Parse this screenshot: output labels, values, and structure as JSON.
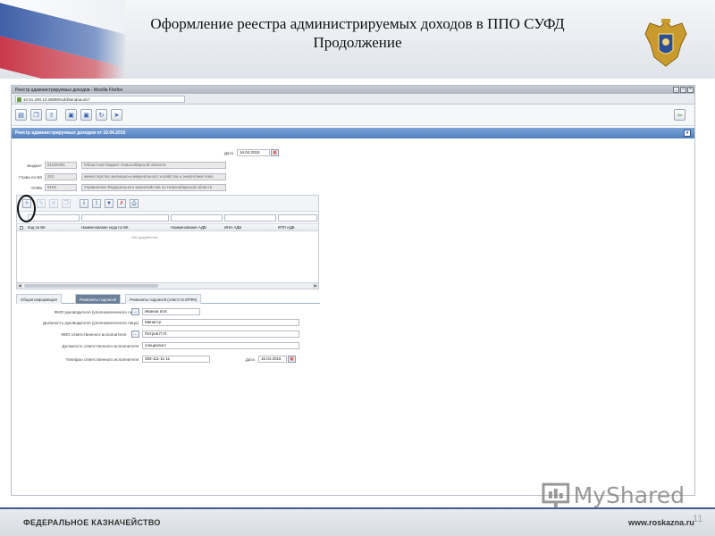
{
  "slide": {
    "title_line1": "Оформление реестра администрируемых доходов в ППО СУФД",
    "title_line2": "Продолжение",
    "footer_left": "ФЕДЕРАЛЬНОЕ КАЗНАЧЕЙСТВО",
    "footer_right": "www.roskazna.ru",
    "page_number": "11",
    "watermark": "MyShared"
  },
  "browser": {
    "window_title": "Реестр администрируемых доходов - Mozilla Firefox",
    "url": "10.51.200.12:28080/sufd/window.do?docSessionId=a72c9abc351bb57caf8d324790c96be6",
    "window_buttons": [
      "_",
      "□",
      "×"
    ]
  },
  "form": {
    "panel_title": "Реестр администрируемых доходов от 16.04.2015",
    "date_label": "Дата",
    "date_value": "16.04.2015",
    "budget_label": "Бюджет",
    "budget_code": "51020491",
    "budget_name": "Областной бюджет Новосибирской области",
    "glava_label": "Глава по БК",
    "glava_code": "210",
    "glava_name": "министерство жилищно-коммунального хозяйства и энергетики Ново",
    "tofk_label": "ТОФК",
    "tofk_code": "5100",
    "tofk_name": "Управление Федерального казначейства по Новосибирской области"
  },
  "grid": {
    "columns": [
      "Код по БК",
      "Наименование кода по БК",
      "Наименование АДБ",
      "ИНН АДБ",
      "КПП АДБ"
    ],
    "empty_message": "Нет документов"
  },
  "tabs": [
    {
      "label": "Общая информация",
      "active": false
    },
    {
      "label": "Реквизиты подписей",
      "active": true
    },
    {
      "label": "Реквизиты подписей (ответств.ОРФК)",
      "active": false
    }
  ],
  "signatures": {
    "head_fio_label": "ФИО руководителя (уполномоченного лица)",
    "head_fio_value": "Иванов И.И.",
    "head_position_label": "Должность руководителя (уполномоченного лица)",
    "head_position_value": "Министр",
    "exec_fio_label": "ФИО ответственного исполнителя",
    "exec_fio_value": "Петров П.П.",
    "exec_position_label": "Должность ответственного исполнителя",
    "exec_position_value": "специалист",
    "phone_label": "Телефон ответственного исполнителя",
    "phone_value": "383-111-11-11",
    "date_label": "Дата",
    "date_value": "16.04.2015",
    "picker_button": "..."
  },
  "icons": {
    "toolbar": [
      "new-doc-icon",
      "copy-doc-icon",
      "export-icon",
      "save-icon",
      "save-as-icon",
      "refresh-icon",
      "send-icon"
    ],
    "grid_toolbar": [
      "add-row-icon",
      "edit-row-icon",
      "delete-row-icon",
      "copy-row-icon",
      "import-icon",
      "export-icon",
      "filter-icon",
      "clear-filter-icon",
      "print-icon"
    ]
  }
}
